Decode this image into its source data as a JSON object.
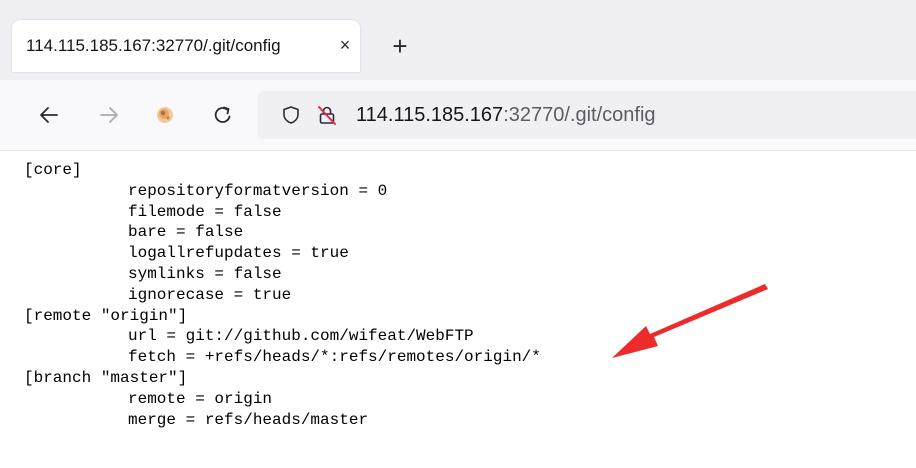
{
  "browser": {
    "tab": {
      "title": "114.115.185.167:32770/.git/config",
      "close_glyph": "×"
    },
    "new_tab_glyph": "+",
    "address": {
      "host": "114.115.185.167",
      "rest": ":32770/.git/config"
    },
    "icons": [
      "back-icon",
      "forward-icon",
      "extension-icon",
      "reload-icon",
      "shield-icon",
      "insecure-lock-icon"
    ]
  },
  "content": {
    "lines": [
      {
        "indent": false,
        "text": "[core]"
      },
      {
        "indent": true,
        "text": "repositoryformatversion = 0"
      },
      {
        "indent": true,
        "text": "filemode = false"
      },
      {
        "indent": true,
        "text": "bare = false"
      },
      {
        "indent": true,
        "text": "logallrefupdates = true"
      },
      {
        "indent": true,
        "text": "symlinks = false"
      },
      {
        "indent": true,
        "text": "ignorecase = true"
      },
      {
        "indent": false,
        "text": "[remote \"origin\"]"
      },
      {
        "indent": true,
        "text": "url = git://github.com/wifeat/WebFTP"
      },
      {
        "indent": true,
        "text": "fetch = +refs/heads/*:refs/remotes/origin/*"
      },
      {
        "indent": false,
        "text": "[branch \"master\"]"
      },
      {
        "indent": true,
        "text": "remote = origin"
      },
      {
        "indent": true,
        "text": "merge = refs/heads/master"
      }
    ]
  },
  "annotation": {
    "arrow_color": "#ee2b2b",
    "points_to": "url = git://github.com/wifeat/WebFTP"
  }
}
